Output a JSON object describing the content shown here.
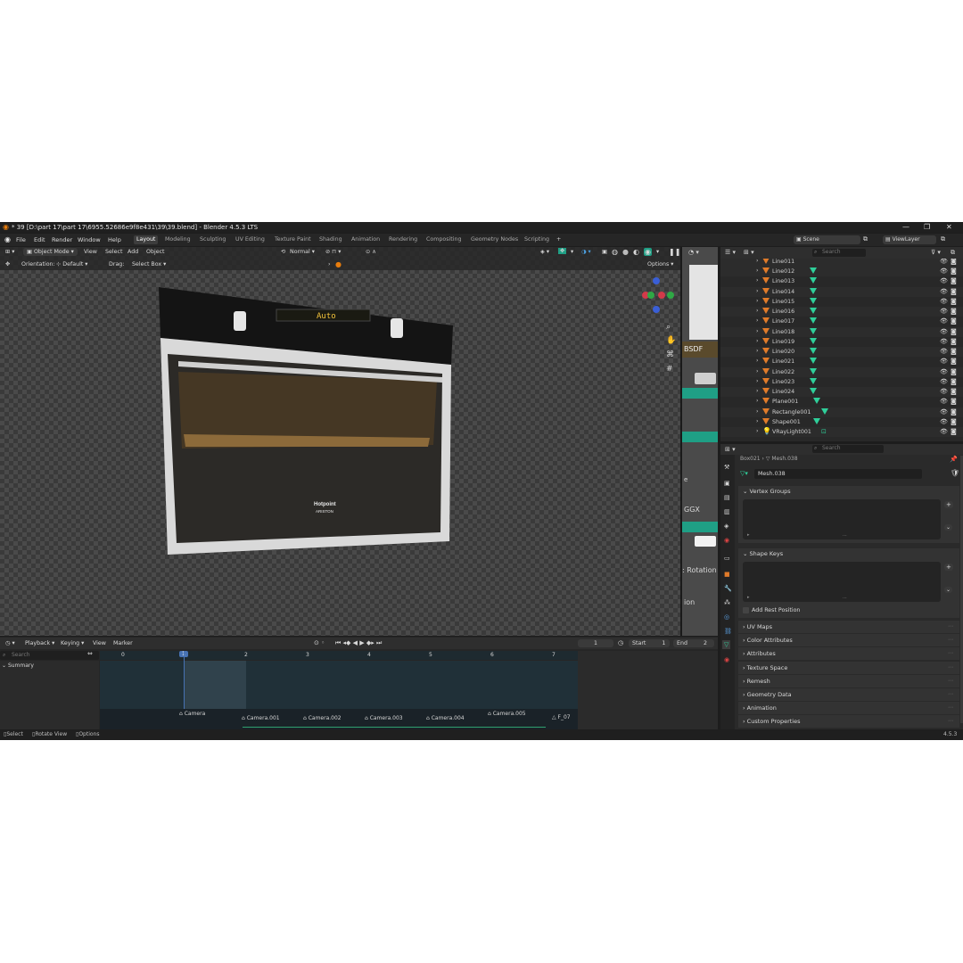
{
  "title_bar": {
    "title": "* 39 [D:\\part 17\\part 17\\6955.52686e9f8e431\\39\\39.blend] - Blender 4.5.3 LTS"
  },
  "menu": [
    "File",
    "Edit",
    "Render",
    "Window",
    "Help"
  ],
  "workspaces": [
    "Layout",
    "Modeling",
    "Sculpting",
    "UV Editing",
    "Texture Paint",
    "Shading",
    "Animation",
    "Rendering",
    "Compositing",
    "Geometry Nodes",
    "Scripting"
  ],
  "active_workspace": "Layout",
  "scene": {
    "scene_label": "Scene",
    "viewlayer_label": "ViewLayer"
  },
  "viewport": {
    "mode": "Object Mode",
    "view": "View",
    "select": "Select",
    "add": "Add",
    "object": "Object",
    "orientation_label": "Orientation:",
    "orientation": "Default",
    "drag_label": "Drag:",
    "drag": "Select Box",
    "transform": "Normal",
    "options": "Options",
    "oven_display": "Auto",
    "brand1": "Hotpoint",
    "brand2": "ARISTON"
  },
  "node_editor": {
    "bsdf": "BSDF",
    "ggx": "GGX",
    "rotation": "Rotation",
    "ion": "ion",
    "e": "e"
  },
  "timeline": {
    "playback": "Playback",
    "keying": "Keying",
    "view": "View",
    "marker": "Marker",
    "current_frame": "1",
    "start_label": "Start",
    "start": "1",
    "end_label": "End",
    "end": "2",
    "search_placeholder": "Search",
    "summary": "Summary",
    "ticks": [
      "0",
      "1",
      "2",
      "3",
      "4",
      "5",
      "6",
      "7"
    ],
    "markers": [
      "Camera",
      "Camera.001",
      "Camera.002",
      "Camera.003",
      "Camera.004",
      "Camera.005",
      "F_07"
    ]
  },
  "outliner": {
    "search_placeholder": "Search",
    "top_item": "Line011",
    "items": [
      "Line012",
      "Line013",
      "Line014",
      "Line015",
      "Line016",
      "Line017",
      "Line018",
      "Line019",
      "Line020",
      "Line021",
      "Line022",
      "Line023",
      "Line024",
      "Plane001",
      "Rectangle001",
      "Shape001",
      "VRayLight001"
    ]
  },
  "properties": {
    "search_placeholder": "Search",
    "breadcrumb_obj": "Box021",
    "breadcrumb_mesh": "Mesh.038",
    "mesh_name": "Mesh.038",
    "vertex_groups": "Vertex Groups",
    "shape_keys": "Shape Keys",
    "add_rest_position": "Add Rest Position",
    "sections": [
      "UV Maps",
      "Color Attributes",
      "Attributes",
      "Texture Space",
      "Remesh",
      "Geometry Data",
      "Animation",
      "Custom Properties"
    ]
  },
  "status_bar": {
    "select": "Select",
    "rotate": "Rotate View",
    "options": "Options",
    "version": "4.5.3"
  },
  "colors": {
    "accent": "#4772b3",
    "mesh_orange": "#e07b2a",
    "data_green": "#2fcf9a",
    "node_teal": "#1f9f85"
  }
}
